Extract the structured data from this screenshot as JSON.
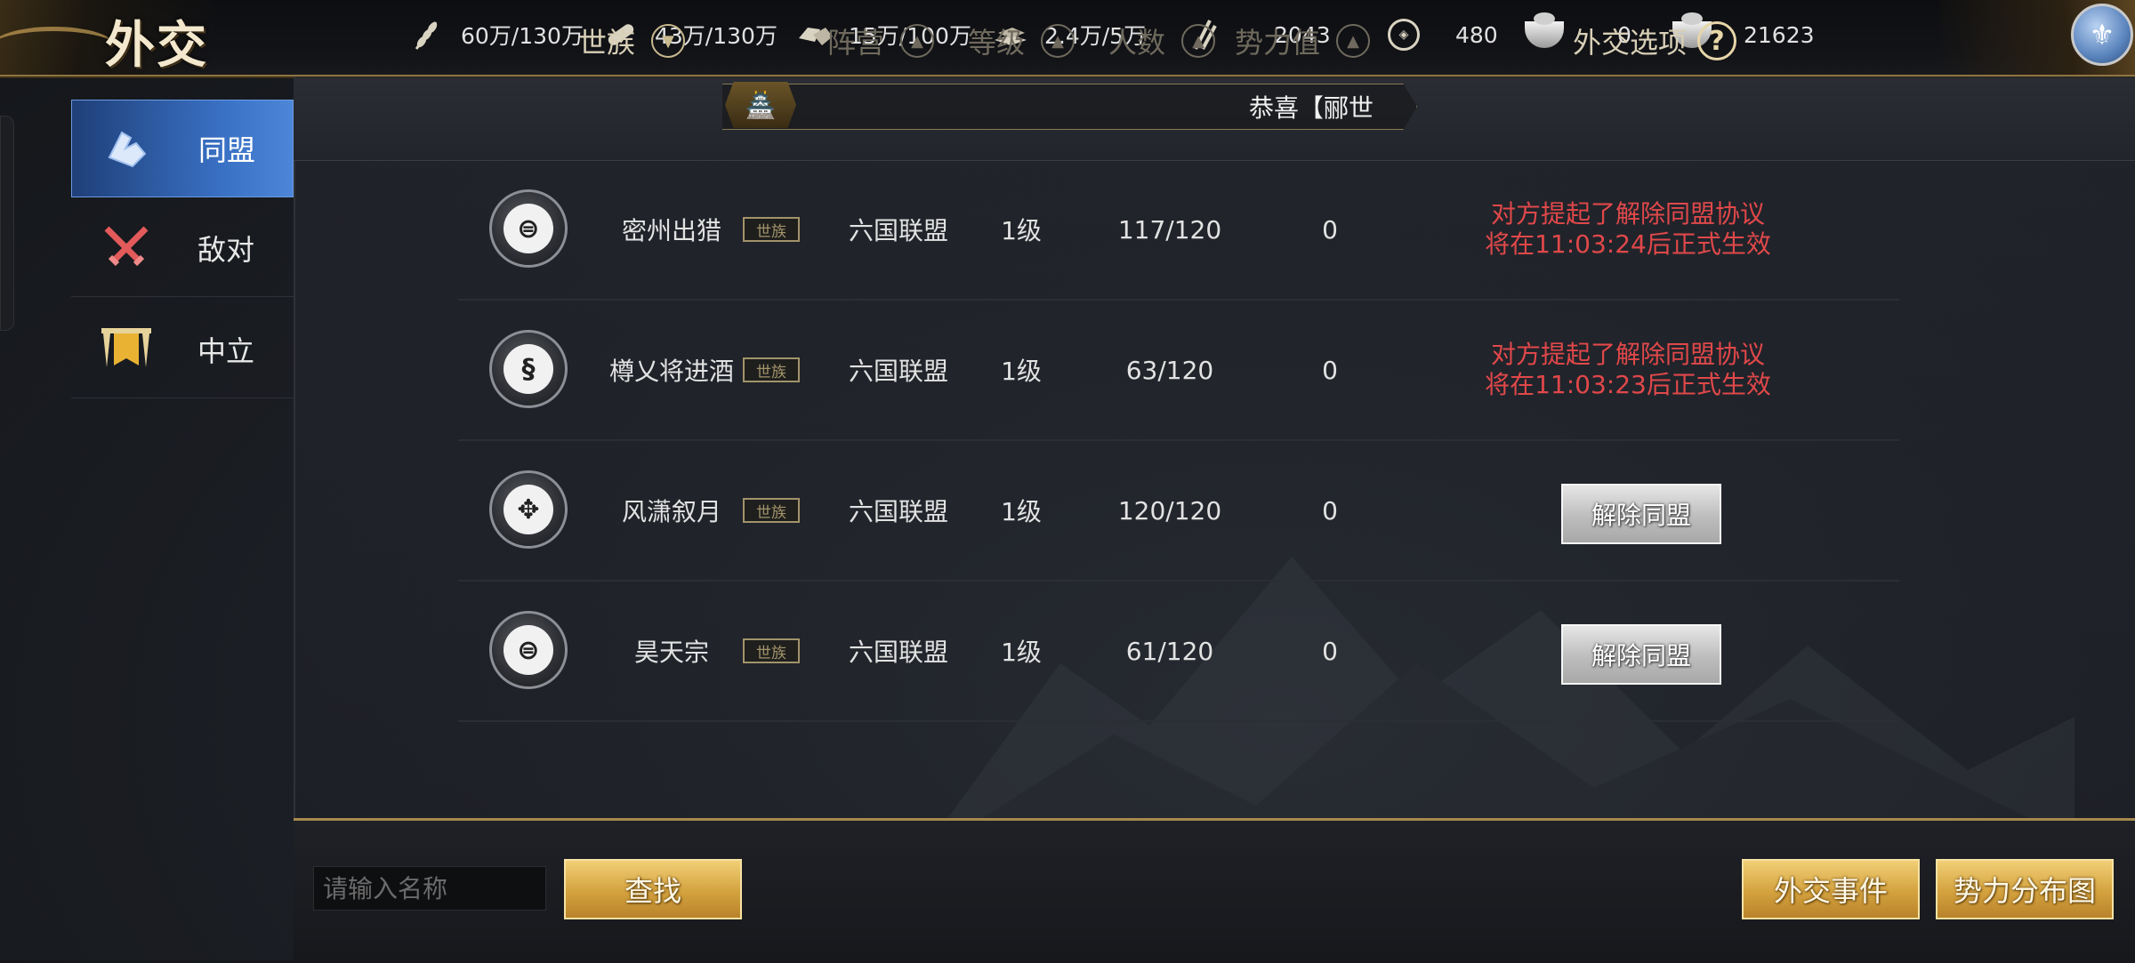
{
  "page_title": "外交",
  "resources": [
    {
      "icon": "grain-icon",
      "value": "60万/130万"
    },
    {
      "icon": "wood-icon",
      "value": "43万/130万"
    },
    {
      "icon": "stone-icon",
      "value": "15万/100万"
    },
    {
      "icon": "iron-icon",
      "value": "2.4万/5万"
    },
    {
      "icon": "troops-icon",
      "value": "2043"
    },
    {
      "icon": "copper-coin-icon",
      "value": "480"
    },
    {
      "icon": "gold-ingot-icon",
      "value": "0"
    },
    {
      "icon": "silver-ingot-icon",
      "value": "21623"
    }
  ],
  "sidebar": {
    "items": [
      {
        "label": "同盟",
        "icon": "handshake-icon",
        "active": true
      },
      {
        "label": "敌对",
        "icon": "crossed-swords-icon",
        "active": false
      },
      {
        "label": "中立",
        "icon": "banner-icon",
        "active": false
      }
    ]
  },
  "table": {
    "headers": {
      "clan": "世族",
      "camp": "阵营",
      "level": "等级",
      "members": "人数",
      "power": "势力值",
      "options": "外交选项"
    },
    "notice": "恭喜【郦世",
    "clan_tag": "世族",
    "rows": [
      {
        "name": "密州出猎",
        "camp": "六国联盟",
        "level": "1级",
        "members": "117/120",
        "power": "0",
        "status_line1": "对方提起了解除同盟协议",
        "status_line2": "将在11:03:24后正式生效",
        "action": ""
      },
      {
        "name": "樽乂将进酒",
        "camp": "六国联盟",
        "level": "1级",
        "members": "63/120",
        "power": "0",
        "status_line1": "对方提起了解除同盟协议",
        "status_line2": "将在11:03:23后正式生效",
        "action": ""
      },
      {
        "name": "风潇叙月",
        "camp": "六国联盟",
        "level": "1级",
        "members": "120/120",
        "power": "0",
        "status_line1": "",
        "status_line2": "",
        "action": "解除同盟"
      },
      {
        "name": "昊天宗",
        "camp": "六国联盟",
        "level": "1级",
        "members": "61/120",
        "power": "0",
        "status_line1": "",
        "status_line2": "",
        "action": "解除同盟"
      }
    ]
  },
  "bottom": {
    "search_placeholder": "请输入名称",
    "search_label": "查找",
    "events_label": "外交事件",
    "map_label": "势力分布图"
  },
  "colors": {
    "accent_gold": "#d4a23f",
    "warning_red": "#e0484a",
    "active_blue": "#3a72c6"
  }
}
